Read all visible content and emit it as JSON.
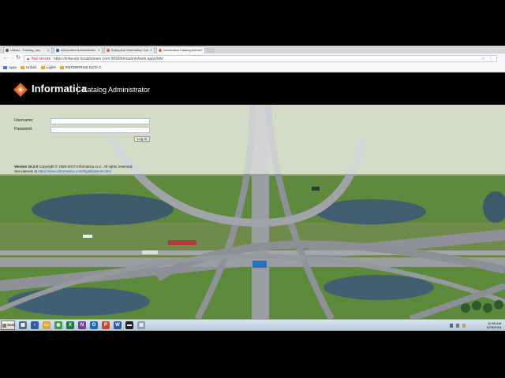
{
  "browser": {
    "tabs": [
      {
        "label": "Unfold - Training_ses",
        "favicon_color": "#5b5b5b",
        "active": false
      },
      {
        "label": "Informatica Administrator",
        "favicon_color": "#2f5f9f",
        "active": false
      },
      {
        "label": "Enterprise Information Cat",
        "favicon_color": "#e8642b",
        "active": false
      },
      {
        "label": "Informatica Catalog Admin",
        "favicon_color": "#e8642b",
        "active": true
      }
    ],
    "back_icon": "back-arrow-icon",
    "forward_icon": "forward-arrow-icon",
    "reload_icon": "reload-icon",
    "not_secure_label": "Not secure",
    "url": "https://infaceip.localdomain.com:9093/ldmadmin/web.apps/ldm",
    "bookmarks": [
      {
        "label": "Apps",
        "color": "#4a7bd0"
      },
      {
        "label": "Unfold",
        "color": "#e8a33b"
      },
      {
        "label": "Ligble",
        "color": "#e8a33b"
      },
      {
        "label": "ENTERPRISE DATA C",
        "color": "#e8a33b"
      }
    ]
  },
  "app": {
    "brand": "Informatica",
    "title": "Catalog Administrator",
    "accent": "#e8642b"
  },
  "login": {
    "username_label": "Username:",
    "password_label": "Password:",
    "username_value": "",
    "password_value": "",
    "button_label": "Log In",
    "version_label": "Version",
    "version_number": "10.2.0",
    "copyright": "Copyright © 1993-2017 Informatica LLC. All rights reserved.",
    "patents_prefix": "See patents at",
    "patents_link": "https://www.informatica.com/legal/patents.html"
  },
  "taskbar": {
    "start_label": "Start",
    "pinned": [
      {
        "name": "server-manager-icon",
        "color": "#4d6d8f",
        "glyph": "▦"
      },
      {
        "name": "powershell-icon",
        "color": "#2e5c9c",
        "glyph": "›"
      },
      {
        "name": "explorer-icon",
        "color": "#d9a93a",
        "glyph": "▭"
      },
      {
        "name": "chrome-icon",
        "color": "#3a9a4a",
        "glyph": "◉"
      },
      {
        "name": "excel-icon",
        "color": "#1e7a43",
        "glyph": "X"
      },
      {
        "name": "onenote-icon",
        "color": "#7b3d9c",
        "glyph": "N"
      },
      {
        "name": "outlook-icon",
        "color": "#1e6bb8",
        "glyph": "O"
      },
      {
        "name": "powerpoint-icon",
        "color": "#c84a2a",
        "glyph": "P"
      },
      {
        "name": "word-icon",
        "color": "#2b5aa8",
        "glyph": "W"
      },
      {
        "name": "command-prompt-icon",
        "color": "#222222",
        "glyph": "▬"
      },
      {
        "name": "document-icon",
        "color": "#8aa0b8",
        "glyph": "▤"
      }
    ],
    "time": "10:55 AM",
    "date": "6/29/2018"
  }
}
